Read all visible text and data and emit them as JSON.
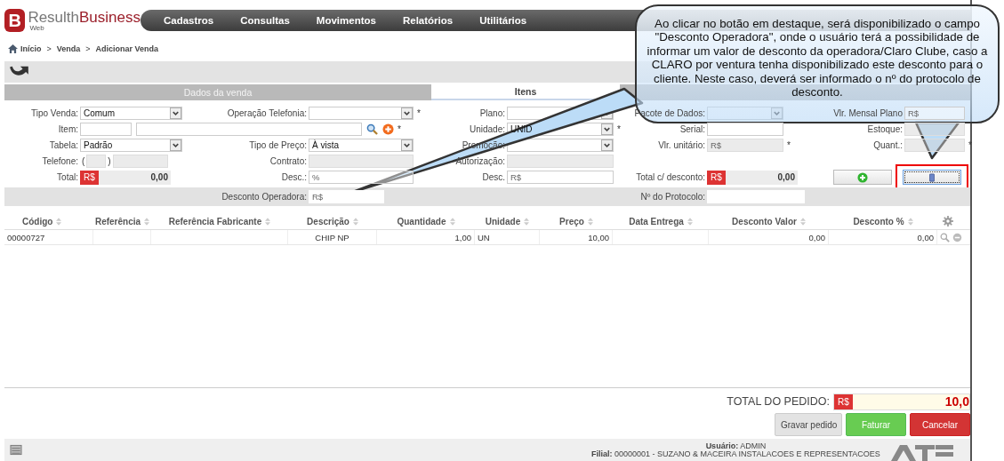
{
  "header": {
    "logo": {
      "letter": "B",
      "brand_light": "Resulth",
      "brand_bold": "Business",
      "sub": "Web"
    },
    "menu": [
      {
        "label": "Cadastros"
      },
      {
        "label": "Consultas"
      },
      {
        "label": "Movimentos"
      },
      {
        "label": "Relatórios"
      },
      {
        "label": "Utilitários"
      }
    ]
  },
  "breadcrumb": {
    "separator": ">",
    "items": [
      "Início",
      "Venda",
      "Adicionar Venda"
    ]
  },
  "tabs": [
    {
      "label": "Dados da venda",
      "selected": false
    },
    {
      "label": "Itens",
      "selected": true
    },
    {
      "selected": false
    }
  ],
  "form": {
    "rows": [
      [
        {
          "label": "Tipo Venda:",
          "kind": "select",
          "value": "Comum"
        },
        {
          "label": "Operação Telefonia:",
          "kind": "select",
          "mark": "*"
        },
        {
          "label": "Plano:",
          "kind": "select"
        },
        {
          "label": "Pacote de Dados:",
          "kind": "select"
        },
        {
          "label": "Vlr. Mensal Plano",
          "kind": "input",
          "placeholder": "R$"
        }
      ],
      [
        {
          "label": "Item:",
          "kind": "input"
        },
        {
          "kind": "item_search",
          "mark": "*"
        },
        {
          "label": "Unidade:",
          "kind": "select",
          "value": "UNID",
          "mark": "*"
        },
        {
          "label": "Serial:",
          "kind": "input"
        },
        {
          "label": "Estoque:",
          "kind": "input",
          "disabled": true
        }
      ],
      [
        {
          "label": "Tabela:",
          "kind": "select",
          "value": "Padrão"
        },
        {
          "label": "Tipo de Preço:",
          "kind": "select",
          "value": "À vista"
        },
        {
          "label": "Promoção:",
          "kind": "select"
        },
        {
          "label": "Vlr. unitário:",
          "kind": "input",
          "placeholder": "R$",
          "disabled": true,
          "mark": "*"
        },
        {
          "label": "Quant.:",
          "kind": "input",
          "disabled": true,
          "mark": "*"
        }
      ],
      [
        {
          "label": "Telefone:",
          "kind": "phone",
          "open": "(",
          "close": ")",
          "disabled": true
        },
        {
          "label": "Contrato:",
          "kind": "input",
          "disabled": true
        },
        {
          "label": "Autorização:",
          "kind": "input",
          "disabled": true
        },
        {
          "kind": "empty"
        },
        {
          "kind": "empty"
        }
      ],
      [
        {
          "label": "Total:",
          "kind": "money",
          "currency": "R$",
          "value": "0,00"
        },
        {
          "label": "Desc.:",
          "kind": "input",
          "placeholder": "%"
        },
        {
          "label": "Desc.",
          "kind": "input",
          "placeholder": "R$"
        },
        {
          "label": "Total c/ desconto:",
          "kind": "money",
          "currency": "R$",
          "value": "0,00"
        },
        {
          "kind": "actions",
          "highlighted": true
        }
      ]
    ],
    "band": [
      {
        "kind": "empty"
      },
      {
        "label": "Desconto Operadora:",
        "kind": "input",
        "placeholder": "R$"
      },
      {
        "kind": "empty"
      },
      {
        "label": "Nº do Protocolo:",
        "kind": "input"
      }
    ]
  },
  "table": {
    "columns": [
      {
        "label": "Código"
      },
      {
        "label": "Referência"
      },
      {
        "label": "Referência Fabricante"
      },
      {
        "label": "Descrição"
      },
      {
        "label": "Quantidade"
      },
      {
        "label": "Unidade"
      },
      {
        "label": "Preço"
      },
      {
        "label": "Data Entrega"
      },
      {
        "label": "Desconto Valor"
      },
      {
        "label": "Desconto %"
      }
    ],
    "rows": [
      {
        "cells": [
          "00000727",
          "",
          "",
          "CHIP NP",
          "1,00",
          "UN",
          "10,00",
          "",
          "0,00",
          "0,00"
        ]
      }
    ]
  },
  "total": {
    "label": "TOTAL DO PEDIDO:",
    "currency": "R$",
    "value": "10,0"
  },
  "buttons": [
    {
      "label": "Gravar pedido",
      "kind": "neutral"
    },
    {
      "label": "Faturar",
      "kind": "success"
    },
    {
      "label": "Cancelar",
      "kind": "danger"
    }
  ],
  "footer": {
    "user_label": "Usuário:",
    "user": "ADMIN",
    "branch_label": "Filial:",
    "branch": "00000001 - SUZANO & MACEIRA INSTALACOES E REPRESENTACOES"
  },
  "callout": {
    "text": "Ao clicar no botão em destaque, será disponibilizado o campo \"Desconto Operadora\", onde o usuário terá a possibilidade de informar um valor de desconto da operadora/Claro Clube, caso a CLARO por ventura tenha disponibilizado este desconto para o cliente. Neste caso, deverá ser informado o nº do protocolo de desconto."
  }
}
